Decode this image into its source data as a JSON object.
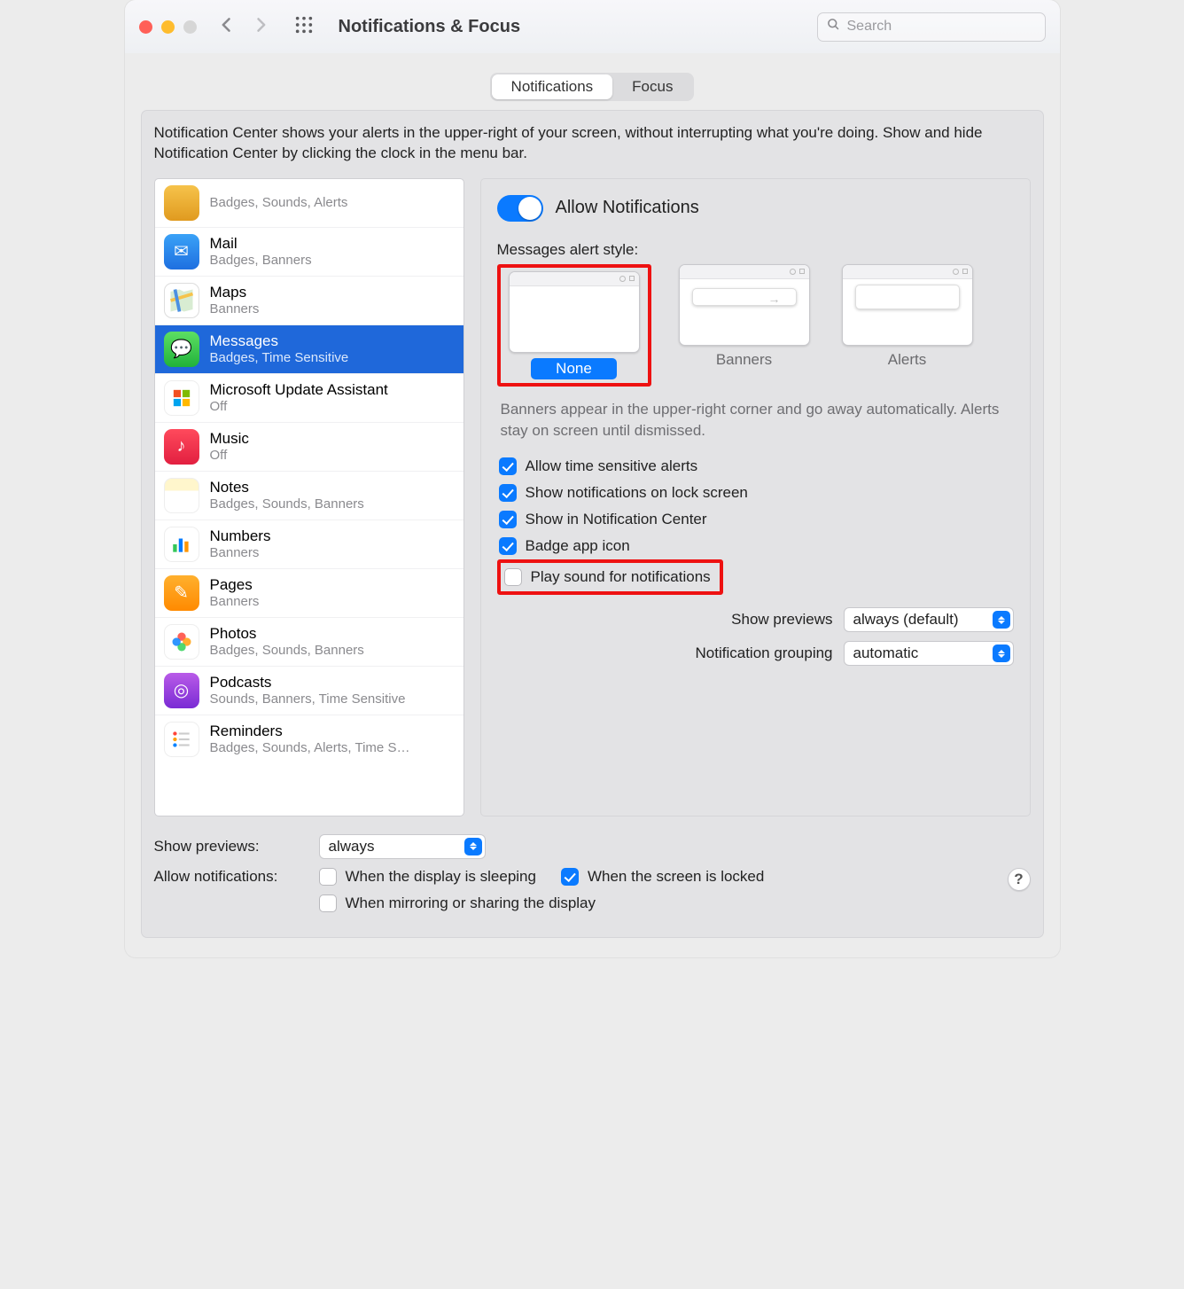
{
  "titlebar": {
    "title": "Notifications & Focus",
    "search_placeholder": "Search"
  },
  "tabs": {
    "left": "Notifications",
    "right": "Focus"
  },
  "description": "Notification Center shows your alerts in the upper-right of your screen, without interrupting what you're doing. Show and hide Notification Center by clicking the clock in the menu bar.",
  "apps": [
    {
      "name": "",
      "sub": "Badges, Sounds, Alerts",
      "icon_class": "ic-keys",
      "icon_name": "keychain-icon"
    },
    {
      "name": "Mail",
      "sub": "Badges, Banners",
      "icon_class": "ic-mail",
      "icon_name": "mail-icon"
    },
    {
      "name": "Maps",
      "sub": "Banners",
      "icon_class": "ic-maps",
      "icon_name": "maps-icon"
    },
    {
      "name": "Messages",
      "sub": "Badges, Time Sensitive",
      "icon_class": "ic-messages",
      "icon_name": "messages-icon",
      "selected": true
    },
    {
      "name": "Microsoft Update Assistant",
      "sub": "Off",
      "icon_class": "ic-msu",
      "icon_name": "microsoft-update-icon"
    },
    {
      "name": "Music",
      "sub": "Off",
      "icon_class": "ic-music",
      "icon_name": "music-icon"
    },
    {
      "name": "Notes",
      "sub": "Badges, Sounds, Banners",
      "icon_class": "ic-notes",
      "icon_name": "notes-icon"
    },
    {
      "name": "Numbers",
      "sub": "Banners",
      "icon_class": "ic-numbers",
      "icon_name": "numbers-icon"
    },
    {
      "name": "Pages",
      "sub": "Banners",
      "icon_class": "ic-pages",
      "icon_name": "pages-icon"
    },
    {
      "name": "Photos",
      "sub": "Badges, Sounds, Banners",
      "icon_class": "ic-photos",
      "icon_name": "photos-icon"
    },
    {
      "name": "Podcasts",
      "sub": "Sounds, Banners, Time Sensitive",
      "icon_class": "ic-podcasts",
      "icon_name": "podcasts-icon"
    },
    {
      "name": "Reminders",
      "sub": "Badges, Sounds, Alerts, Time S…",
      "icon_class": "ic-reminders",
      "icon_name": "reminders-icon"
    }
  ],
  "detail": {
    "allow_notifications": "Allow Notifications",
    "style_heading": "Messages alert style:",
    "styles": {
      "none": "None",
      "banners": "Banners",
      "alerts": "Alerts"
    },
    "style_hint": "Banners appear in the upper-right corner and go away automatically. Alerts stay on screen until dismissed.",
    "checks": {
      "time_sensitive": "Allow time sensitive alerts",
      "lock_screen": "Show notifications on lock screen",
      "notification_center": "Show in Notification Center",
      "badge": "Badge app icon",
      "sound": "Play sound for notifications"
    },
    "selects": {
      "previews_label": "Show previews",
      "previews_value": "always (default)",
      "grouping_label": "Notification grouping",
      "grouping_value": "automatic"
    }
  },
  "bottom": {
    "previews_label": "Show previews:",
    "previews_value": "always",
    "allow_label": "Allow notifications:",
    "when_sleeping": "When the display is sleeping",
    "when_locked": "When the screen is locked",
    "when_mirroring": "When mirroring or sharing the display"
  },
  "help": "?"
}
